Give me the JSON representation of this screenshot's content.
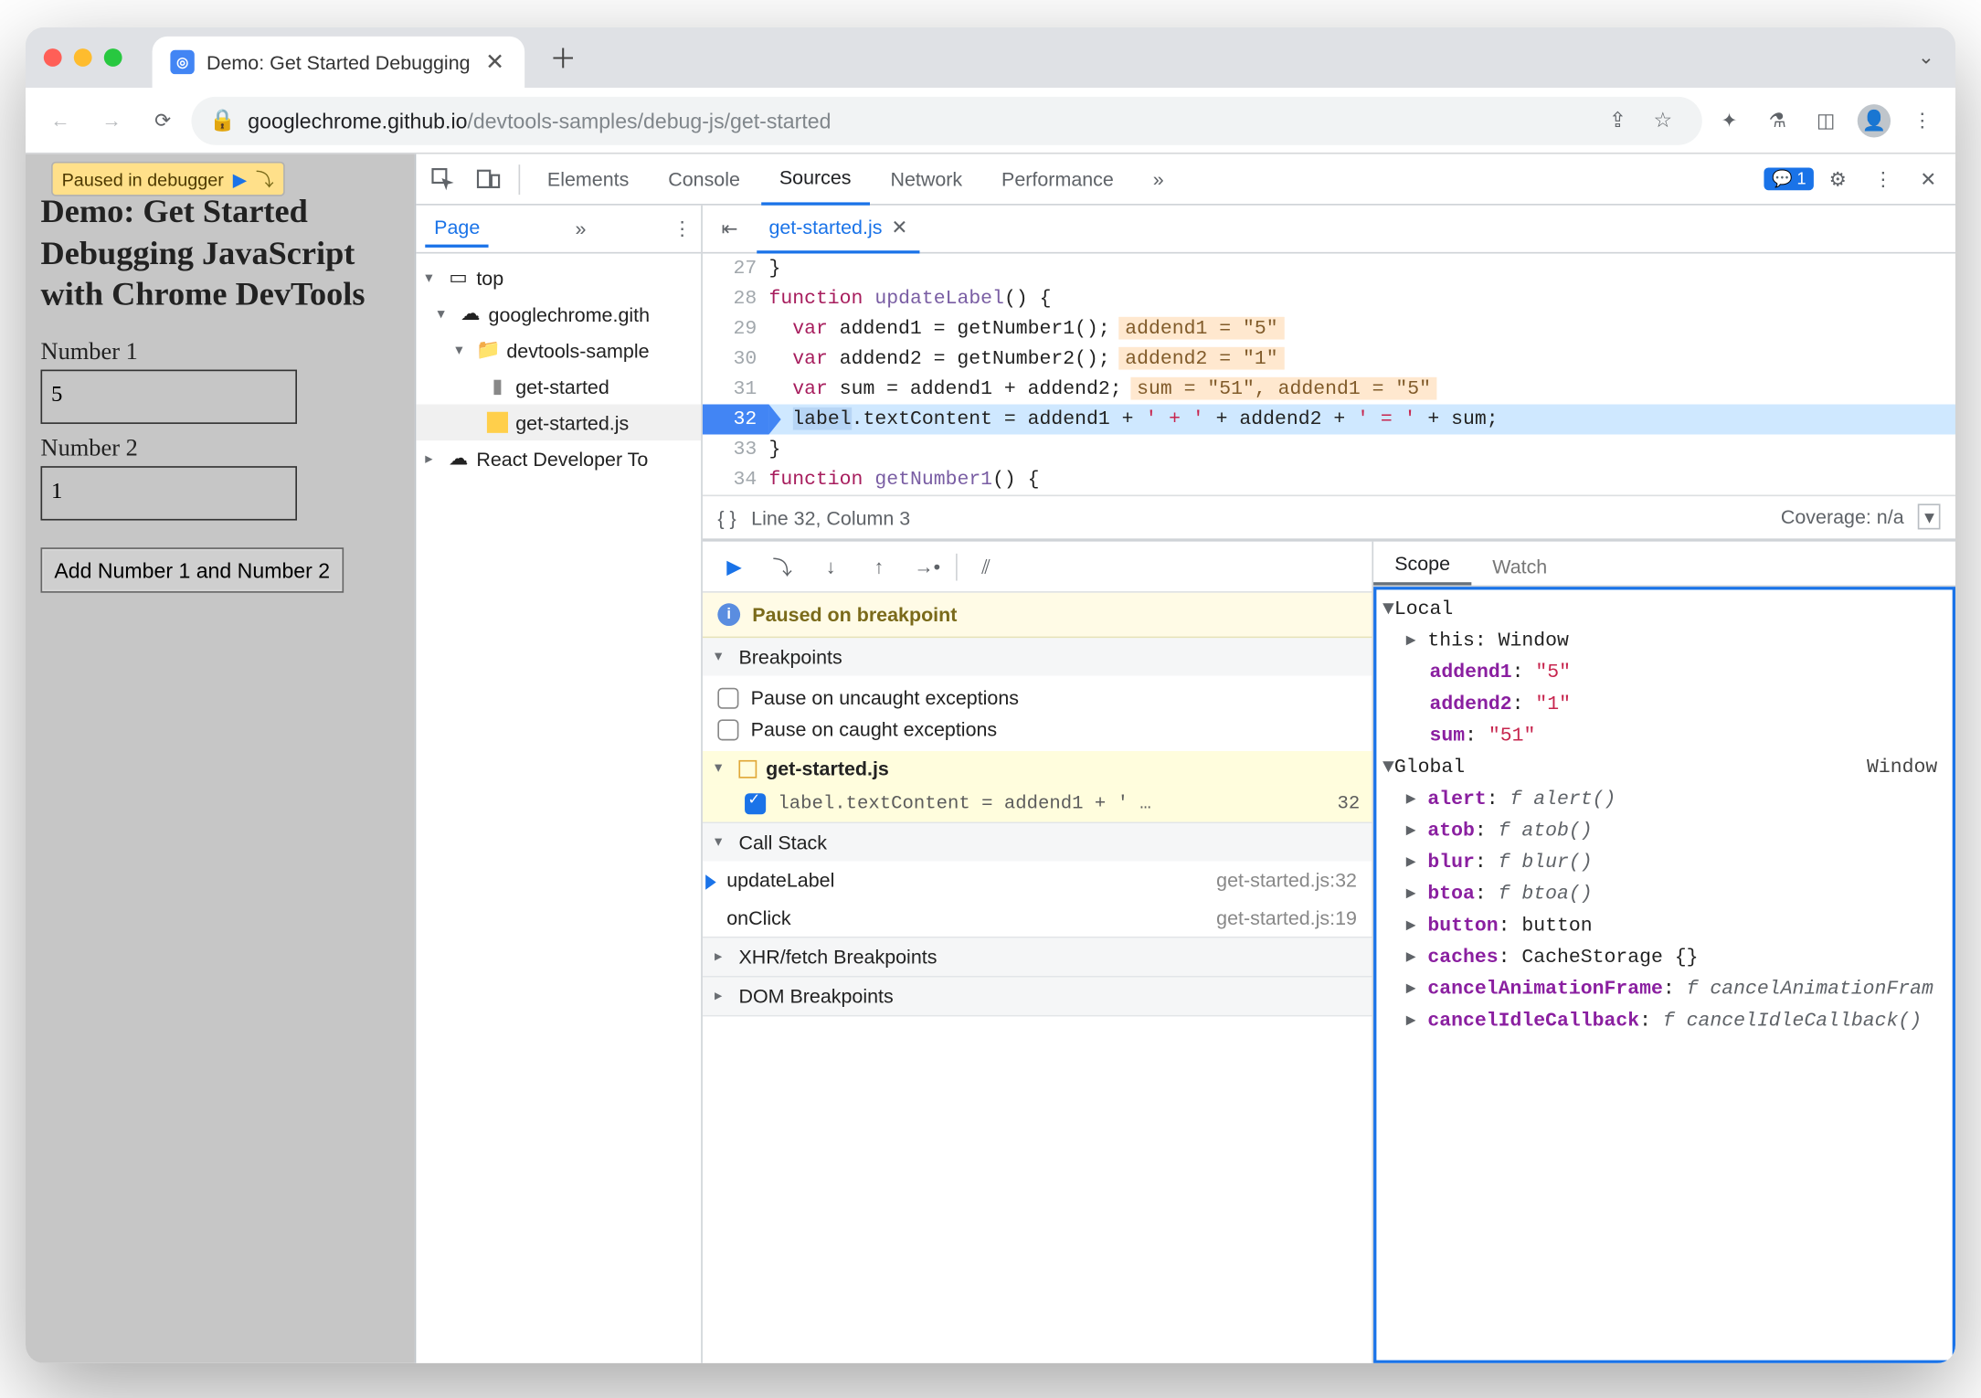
{
  "browser": {
    "tab_title": "Demo: Get Started Debugging",
    "url_host": "googlechrome.github.io",
    "url_path": "/devtools-samples/debug-js/get-started"
  },
  "page": {
    "paused_chip": "Paused in debugger",
    "heading": "Demo: Get Started Debugging JavaScript with Chrome DevTools",
    "label1": "Number 1",
    "input1_value": "5",
    "label2": "Number 2",
    "input2_value": "1",
    "button": "Add Number 1 and Number 2"
  },
  "devtools": {
    "tabs": {
      "elements": "Elements",
      "console": "Console",
      "sources": "Sources",
      "network": "Network",
      "performance": "Performance"
    },
    "issues_count": "1",
    "navigator": {
      "page_tab": "Page",
      "top": "top",
      "domain": "googlechrome.gith",
      "folder": "devtools-sample",
      "html": "get-started",
      "js": "get-started.js",
      "react_ext": "React Developer To"
    },
    "editor": {
      "filename": "get-started.js",
      "lines": {
        "l27": "}",
        "l28a": "function",
        "l28b": "updateLabel",
        "l28c": "() {",
        "l29a": "  var",
        "l29b": " addend1 = getNumber1();",
        "l29i": "addend1 = \"5\"",
        "l30a": "  var",
        "l30b": " addend2 = getNumber2();",
        "l30i": "addend2 = \"1\"",
        "l31a": "  var",
        "l31b": " sum = addend1 + addend2;",
        "l31i": "sum = \"51\", addend1 = \"5\"",
        "l32a": "  ",
        "l32sel": "label",
        "l32b": ".textContent = addend1 + ",
        "l32s1": "' + '",
        "l32c": " + addend2 + ",
        "l32s2": "' = '",
        "l32d": " + sum;",
        "l33": "}",
        "l34a": "function",
        "l34b": "getNumber1",
        "l34c": "() {"
      },
      "status_pos": "Line 32, Column 3",
      "coverage": "Coverage: n/a"
    },
    "debugger": {
      "paused_msg": "Paused on breakpoint",
      "breakpoints": "Breakpoints",
      "pause_uncaught": "Pause on uncaught exceptions",
      "pause_caught": "Pause on caught exceptions",
      "bp_file": "get-started.js",
      "bp_text": "label.textContent = addend1 + ' …",
      "bp_line": "32",
      "callstack": "Call Stack",
      "frame1": "updateLabel",
      "frame1_loc": "get-started.js:32",
      "frame2": "onClick",
      "frame2_loc": "get-started.js:19",
      "xhr": "XHR/fetch Breakpoints",
      "dom": "DOM Breakpoints"
    },
    "scope": {
      "scope_tab": "Scope",
      "watch_tab": "Watch",
      "local": "Local",
      "this": "this",
      "this_v": "Window",
      "addend1": "addend1",
      "addend1_v": "\"5\"",
      "addend2": "addend2",
      "addend2_v": "\"1\"",
      "sum": "sum",
      "sum_v": "\"51\"",
      "global": "Global",
      "global_v": "Window",
      "g": {
        "alert": "alert",
        "alert_v": "f alert()",
        "atob": "atob",
        "atob_v": "f atob()",
        "blur": "blur",
        "blur_v": "f blur()",
        "btoa": "btoa",
        "btoa_v": "f btoa()",
        "button": "button",
        "button_v": "button",
        "caches": "caches",
        "caches_v": "CacheStorage {}",
        "caf": "cancelAnimationFrame",
        "caf_v": "f cancelAnimationFram",
        "cic": "cancelIdleCallback",
        "cic_v": "f cancelIdleCallback()"
      }
    }
  }
}
